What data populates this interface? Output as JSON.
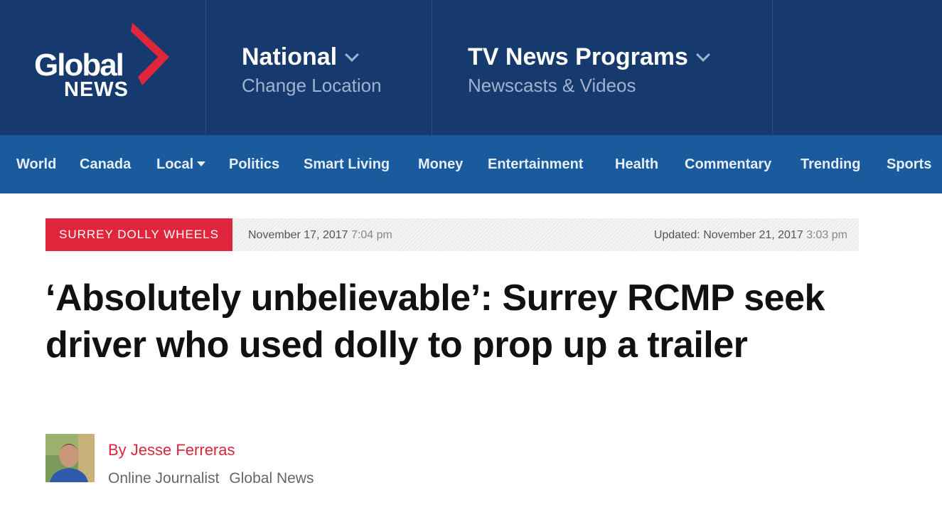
{
  "brand": {
    "logo_word": "Global",
    "logo_sub": "NEWS",
    "header_bg": "#163a6e",
    "nav_bg": "#1a5b9e",
    "accent": "#e0263c"
  },
  "header": {
    "location": {
      "title": "National",
      "subtitle": "Change Location",
      "icon": "chevron-down-icon"
    },
    "programs": {
      "title": "TV News Programs",
      "subtitle": "Newscasts & Videos",
      "icon": "chevron-down-icon"
    }
  },
  "nav": {
    "items": [
      {
        "label": "World"
      },
      {
        "label": "Canada"
      },
      {
        "label": "Local",
        "icon": "caret-down-icon"
      },
      {
        "label": "Politics"
      },
      {
        "label": "Smart Living"
      },
      {
        "label": "Money"
      },
      {
        "label": "Entertainment"
      },
      {
        "label": "Health"
      },
      {
        "label": "Commentary"
      },
      {
        "label": "Trending"
      },
      {
        "label": "Sports"
      }
    ]
  },
  "article": {
    "tag": "SURREY DOLLY WHEELS",
    "published_date": "November 17, 2017",
    "published_time": "7:04 pm",
    "updated_label": "Updated: November 21, 2017",
    "updated_time": "3:03 pm",
    "headline": "‘Absolutely unbelievable’: Surrey RCMP seek driver who used dolly to prop up a trailer",
    "author": "By Jesse Ferreras",
    "author_role": "Online Journalist",
    "author_org": "Global News"
  }
}
